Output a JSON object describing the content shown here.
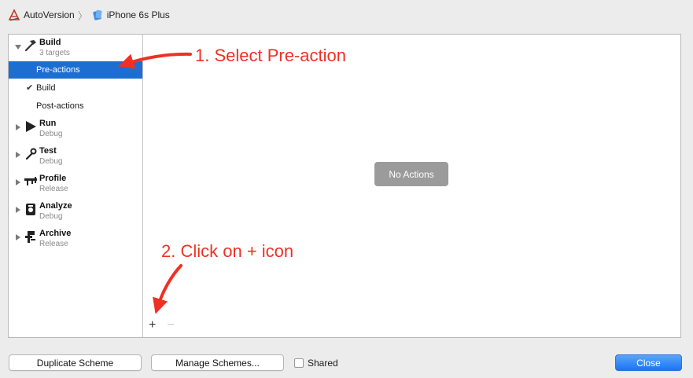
{
  "breadcrumb": {
    "project": "AutoVersion",
    "device": "iPhone 6s Plus"
  },
  "sidebar": {
    "build": {
      "title": "Build",
      "subtitle": "3 targets",
      "items": [
        {
          "label": "Pre-actions",
          "selected": true
        },
        {
          "label": "Build",
          "checked": true
        },
        {
          "label": "Post-actions"
        }
      ]
    },
    "phases": [
      {
        "title": "Run",
        "subtitle": "Debug",
        "icon": "play-icon"
      },
      {
        "title": "Test",
        "subtitle": "Debug",
        "icon": "wrench-icon"
      },
      {
        "title": "Profile",
        "subtitle": "Release",
        "icon": "instruments-icon"
      },
      {
        "title": "Analyze",
        "subtitle": "Debug",
        "icon": "analyze-icon"
      },
      {
        "title": "Archive",
        "subtitle": "Release",
        "icon": "archive-icon"
      }
    ]
  },
  "content": {
    "empty_label": "No Actions",
    "add_symbol": "+",
    "remove_symbol": "−"
  },
  "annotations": {
    "step1": "1. Select Pre-action",
    "step2": "2. Click on + icon"
  },
  "footer": {
    "duplicate": "Duplicate Scheme",
    "manage": "Manage Schemes...",
    "shared": "Shared",
    "shared_checked": false,
    "close": "Close"
  },
  "colors": {
    "selection": "#1c6fd1",
    "annotation": "#ee3124",
    "primary_button": "#1b74f3"
  }
}
